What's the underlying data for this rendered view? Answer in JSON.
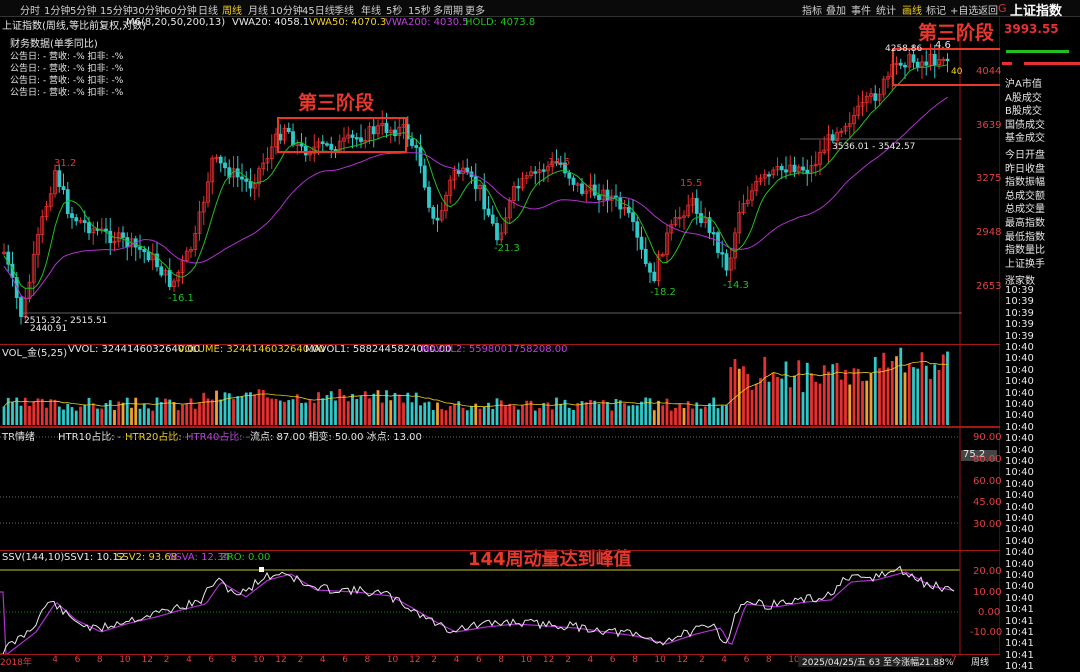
{
  "toolbar": {
    "timeframes": [
      "分时",
      "1分钟",
      "5分钟",
      "15分钟",
      "30分钟",
      "60分钟",
      "日线",
      "周线",
      "月线",
      "10分钟",
      "45日线",
      "季线",
      "年线",
      "5秒",
      "15秒",
      "多周期",
      "更多"
    ],
    "active_timeframe": "周线",
    "tools": [
      "指标",
      "叠加",
      "事件",
      "统计",
      "画线",
      "标记",
      "+自选",
      "返回"
    ],
    "active_tool": "画线",
    "index_name": "上证指数",
    "badge": "G"
  },
  "main_chart": {
    "title": "上证指数(周线,等比前复权,对数)",
    "ma_label": "M6(8,20,50,200,13)",
    "vwa20": "VWA20: 4058.1",
    "vwa50": "VWA50: 4070.3",
    "vwa200": "VWA200: 4030.5",
    "hold": "HOLD: 4073.8",
    "finance_title": "财务数据(单季同比)",
    "finance_rows": [
      "公告日: -   营收: -%   扣非: -%",
      "公告日: -   营收: -%   扣非: -%",
      "公告日: -   营收: -%   扣非: -%",
      "公告日: -   营收: -%   扣非: -%"
    ],
    "stage_label_1": "第三阶段",
    "stage_label_2": "第三阶段",
    "price_top": "3993.55",
    "labels": {
      "p31": "31.2",
      "m16": "-16.1",
      "p14": "14.5",
      "m21": "-21.3",
      "p15": "15.5",
      "m18": "-18.2",
      "m14": "-14.3",
      "p46": "4.6",
      "p40": "40",
      "low_range": "2515.32 - 2515.51",
      "low": "2440.91",
      "mid_range": "3536.01 - 3542.57",
      "high": "4258.86"
    },
    "y_axis": [
      "4044",
      "3639",
      "3275",
      "2948",
      "2653"
    ]
  },
  "side_panel": {
    "items": [
      "沪A市值",
      "A股成交",
      "B股成交",
      "国债成交",
      "基金成交",
      "今日开盘",
      "昨日收盘",
      "指数振幅",
      "总成交额",
      "总成交量",
      "最高指数",
      "最低指数",
      "指数量比",
      "上证换手",
      "涨家数"
    ],
    "times": [
      "10:39",
      "10:39",
      "10:39",
      "10:39",
      "10:39",
      "10:40",
      "10:40",
      "10:40",
      "10:40",
      "10:40",
      "10:40",
      "10:40",
      "10:40",
      "10:40",
      "10:40",
      "10:40",
      "10:40",
      "10:40",
      "10:40",
      "10:40",
      "10:40",
      "10:40",
      "10:40",
      "10:40",
      "10:40",
      "10:40",
      "10:40",
      "10:40",
      "10:41",
      "10:41",
      "10:41",
      "10:41",
      "10:41",
      "10:41"
    ]
  },
  "volume_panel": {
    "title": "VOL_金(5,25)",
    "vvol": "VVOL: 3244146032640.00",
    "volume": "VOLUME: 3244146032640.00",
    "mavol1": "MAVOL1: 5882445824000.00",
    "mavol2": "MAVOL2: 5598001758208.00"
  },
  "tr_panel": {
    "title": "TR情绪",
    "htr10": "HTR10占比: -",
    "htr20": "HTR20占比: -",
    "htr40": "HTR40占比: -",
    "params": "流点: 87.00  相变: 50.00  冰点: 13.00",
    "value": "75.2",
    "y_axis": [
      "90.00",
      "80.00",
      "60.00",
      "45.00",
      "30.00"
    ]
  },
  "ssv_panel": {
    "title": "SSV(144,10)",
    "ssv1": "SSV1: 10.12",
    "ssv2": "SSV2: 93.68",
    "ssva": "SSVA: 12.34",
    "zro": "ZRO: 0.00",
    "annotation": "144周动量达到峰值",
    "y_axis": [
      "20.00",
      "10.00",
      "0.00",
      "-10.00"
    ]
  },
  "x_axis": {
    "ticks": [
      "2018年",
      "4",
      "6",
      "8",
      "10",
      "12",
      "2",
      "4",
      "6",
      "8",
      "10",
      "12",
      "2",
      "4",
      "6",
      "8",
      "10",
      "12",
      "2",
      "4",
      "6",
      "8",
      "10",
      "12",
      "2",
      "4",
      "6",
      "8",
      "10",
      "12",
      "2",
      "4",
      "6",
      "8",
      "10",
      "12",
      "2",
      "4"
    ],
    "status": "2025/04/25/五 63 至今涨幅21.88%",
    "last": "7",
    "period": "周线"
  },
  "colors": {
    "up": "#e83030",
    "down": "#30c8c8",
    "ma_green": "#20c020",
    "ma_purple": "#b030d0",
    "accent_yellow": "#f0d020",
    "annotation_red": "#e8382c"
  }
}
